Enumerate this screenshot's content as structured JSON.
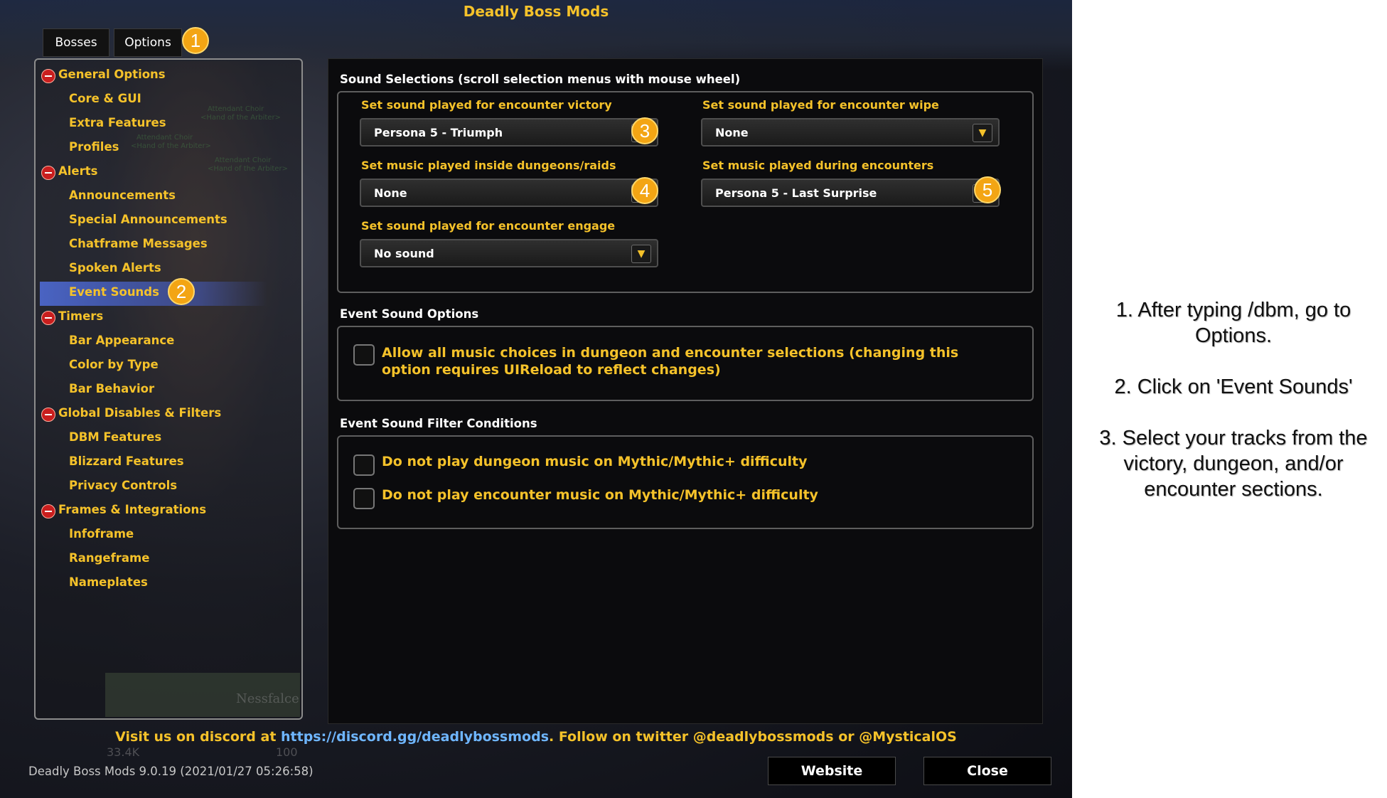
{
  "window": {
    "title": "Deadly Boss Mods"
  },
  "tabs": [
    {
      "label": "Bosses"
    },
    {
      "label": "Options"
    }
  ],
  "badges": [
    "1",
    "2",
    "3",
    "4",
    "5"
  ],
  "tree": {
    "groups": [
      {
        "label": "General Options",
        "children": [
          "Core & GUI",
          "Extra Features",
          "Profiles"
        ]
      },
      {
        "label": "Alerts",
        "children": [
          "Announcements",
          "Special Announcements",
          "Chatframe Messages",
          "Spoken Alerts",
          "Event Sounds"
        ]
      },
      {
        "label": "Timers",
        "children": [
          "Bar Appearance",
          "Color by Type",
          "Bar Behavior"
        ]
      },
      {
        "label": "Global Disables & Filters",
        "children": [
          "DBM Features",
          "Blizzard Features",
          "Privacy Controls"
        ]
      },
      {
        "label": "Frames & Integrations",
        "children": [
          "Infoframe",
          "Rangeframe",
          "Nameplates"
        ]
      }
    ],
    "selected": "Event Sounds"
  },
  "sound_selections": {
    "header": "Sound Selections (scroll selection menus with mouse wheel)",
    "victory": {
      "label": "Set sound played for encounter victory",
      "value": "Persona 5 - Triumph"
    },
    "wipe": {
      "label": "Set sound played for encounter wipe",
      "value": "None"
    },
    "dungeon_music": {
      "label": "Set music played inside dungeons/raids",
      "value": "None"
    },
    "encounter_music": {
      "label": "Set music played during encounters",
      "value": "Persona 5 - Last Surprise"
    },
    "engage": {
      "label": "Set sound played for encounter engage",
      "value": "No sound"
    }
  },
  "event_sound_options": {
    "header": "Event Sound Options",
    "allow_all_music": {
      "label": "Allow all music choices in dungeon and encounter selections (changing this option requires UIReload to reflect changes)",
      "checked": false
    }
  },
  "filter_conditions": {
    "header": "Event Sound Filter Conditions",
    "no_dungeon_music": {
      "label": "Do not play dungeon music on Mythic/Mythic+ difficulty",
      "checked": false
    },
    "no_encounter_music": {
      "label": "Do not play encounter music on Mythic/Mythic+ difficulty",
      "checked": false
    }
  },
  "footer": {
    "prefix": "Visit us on discord at ",
    "link": "https://discord.gg/deadlybossmods",
    "suffix": ". Follow on twitter @deadlybossmods or @MysticalOS"
  },
  "version": "Deadly Boss Mods 9.0.19 (2021/01/27 05:26:58)",
  "buttons": {
    "website": "Website",
    "close": "Close"
  },
  "background_text": {
    "npc1": "Attendant Choir",
    "npc1_sub": "<Hand of the Arbiter>",
    "unit_name": "Nessfalce",
    "health": "33.4K",
    "level": "100"
  },
  "instructions": [
    "1. After typing /dbm, go to Options.",
    "2. Click on 'Event Sounds'",
    "3. Select your tracks from the victory, dungeon, and/or encounter sections."
  ],
  "colors": {
    "accent": "#f5c22a",
    "link": "#6fb6ff",
    "badge": "#f3a514",
    "selected": "#4f6fd6"
  }
}
